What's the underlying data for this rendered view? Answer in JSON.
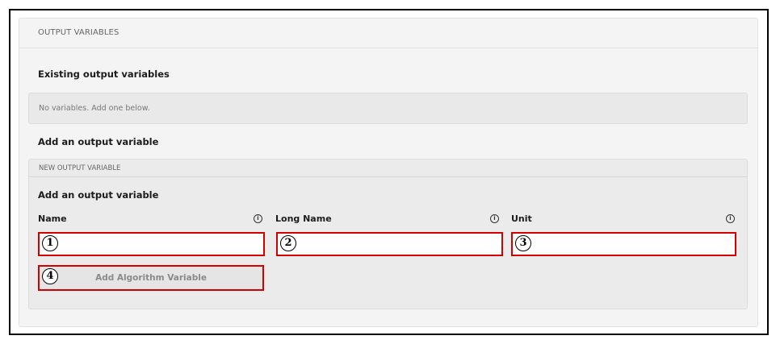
{
  "panel": {
    "header": "OUTPUT VARIABLES",
    "existing_title": "Existing output variables",
    "empty_message": "No variables. Add one below.",
    "add_title": "Add an output variable"
  },
  "new_variable": {
    "header": "NEW OUTPUT VARIABLE",
    "title": "Add an output variable",
    "fields": [
      {
        "label": "Name",
        "value": "",
        "marker": "1",
        "info_icon": "info-icon"
      },
      {
        "label": "Long Name",
        "value": "",
        "marker": "2",
        "info_icon": "info-icon"
      },
      {
        "label": "Unit",
        "value": "",
        "marker": "3",
        "info_icon": "info-icon"
      }
    ],
    "button": {
      "label": "Add Algorithm Variable",
      "marker": "4"
    }
  },
  "colors": {
    "highlight": "#d40000",
    "panel_bg": "#f4f4f4",
    "subpanel_bg": "#ebebeb"
  }
}
